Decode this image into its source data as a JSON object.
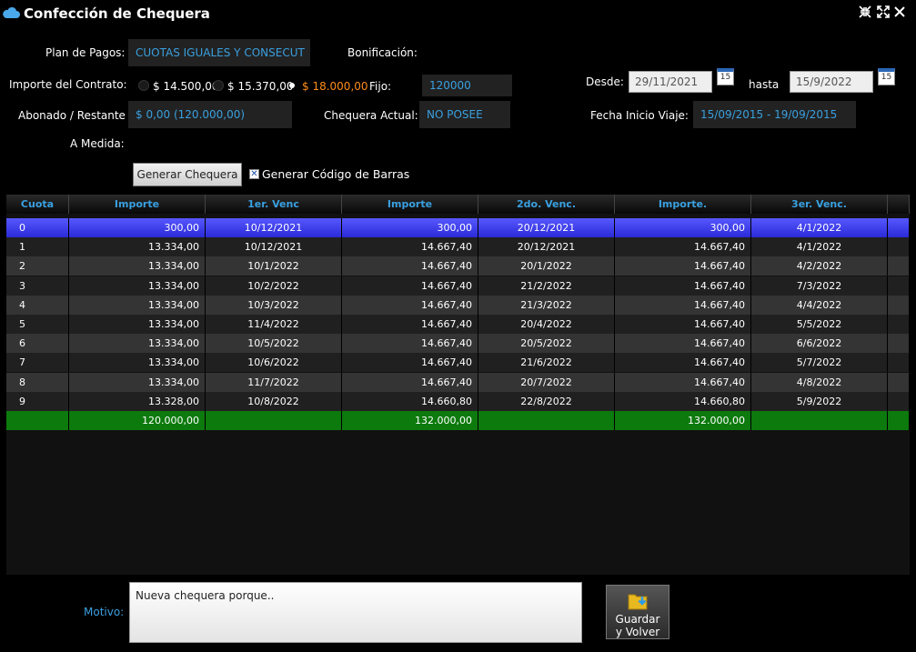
{
  "window": {
    "title": "Confección de Chequera"
  },
  "form": {
    "plan_label": "Plan de Pagos:",
    "plan_value": "CUOTAS IGUALES Y CONSECUT",
    "bonif_label": "Bonificación:",
    "bonif_value": "",
    "importe_label": "Importe del Contrato:",
    "importe_options": [
      "$ 14.500,00",
      "$ 15.370,00",
      "$ 18.000,00"
    ],
    "importe_selected_index": 2,
    "fijo_label": "Fijo:",
    "fijo_value": "120000",
    "desde_label": "Desde:",
    "desde_value": "29/11/2021",
    "hasta_label": "hasta",
    "hasta_value": "15/9/2022",
    "calendar_glyph": "15",
    "abonado_label": "Abonado / Restante",
    "abonado_value": "$ 0,00 (120.000,00)",
    "chequera_label": "Chequera Actual:",
    "chequera_value": "NO POSEE",
    "fecha_viaje_label": "Fecha Inicio Viaje:",
    "fecha_viaje_value": "15/09/2015 - 19/09/2015",
    "medida_label": "A Medida:",
    "generar_button": "Generar Chequera",
    "codigo_barras_label": "Generar Código de Barras",
    "codigo_barras_checked": true
  },
  "table": {
    "headers": [
      "Cuota",
      "Importe",
      "1er. Venc",
      "Importe",
      "2do. Venc.",
      "Importe.",
      "3er. Venc."
    ],
    "rows": [
      [
        "0",
        "300,00",
        "10/12/2021",
        "300,00",
        "20/12/2021",
        "300,00",
        "4/1/2022"
      ],
      [
        "1",
        "13.334,00",
        "10/12/2021",
        "14.667,40",
        "20/12/2021",
        "14.667,40",
        "4/1/2022"
      ],
      [
        "2",
        "13.334,00",
        "10/1/2022",
        "14.667,40",
        "20/1/2022",
        "14.667,40",
        "4/2/2022"
      ],
      [
        "3",
        "13.334,00",
        "10/2/2022",
        "14.667,40",
        "21/2/2022",
        "14.667,40",
        "7/3/2022"
      ],
      [
        "4",
        "13.334,00",
        "10/3/2022",
        "14.667,40",
        "21/3/2022",
        "14.667,40",
        "4/4/2022"
      ],
      [
        "5",
        "13.334,00",
        "11/4/2022",
        "14.667,40",
        "20/4/2022",
        "14.667,40",
        "5/5/2022"
      ],
      [
        "6",
        "13.334,00",
        "10/5/2022",
        "14.667,40",
        "20/5/2022",
        "14.667,40",
        "6/6/2022"
      ],
      [
        "7",
        "13.334,00",
        "10/6/2022",
        "14.667,40",
        "21/6/2022",
        "14.667,40",
        "5/7/2022"
      ],
      [
        "8",
        "13.334,00",
        "11/7/2022",
        "14.667,40",
        "20/7/2022",
        "14.667,40",
        "4/8/2022"
      ],
      [
        "9",
        "13.328,00",
        "10/8/2022",
        "14.660,80",
        "22/8/2022",
        "14.660,80",
        "5/9/2022"
      ]
    ],
    "selected_row": 0,
    "totals": [
      "",
      "120.000,00",
      "",
      "132.000,00",
      "",
      "132.000,00",
      ""
    ]
  },
  "footer": {
    "motivo_label": "Motivo:",
    "motivo_value": "Nueva chequera porque..",
    "save_button_line1": "Guardar",
    "save_button_line2": "y Volver"
  },
  "colors": {
    "accent": "#39a0e0",
    "selected_row": "#3a3aff",
    "totals_row": "#0d7a0d",
    "selected_option": "#ff8c1a"
  }
}
